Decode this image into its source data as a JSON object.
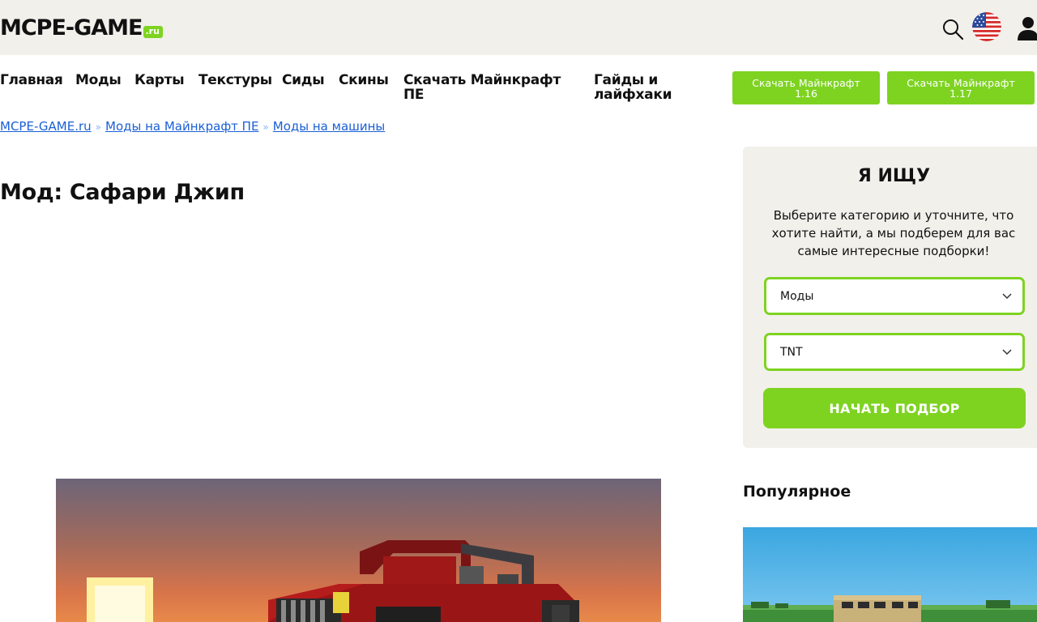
{
  "header": {
    "logo_main": "MCPE-GAME",
    "logo_tld": ".ru"
  },
  "nav": {
    "items": [
      "Главная",
      "Моды",
      "Карты",
      "Текстуры",
      "Сиды",
      "Скины"
    ],
    "download_pe": [
      "Скачать Майнкрафт",
      "ПЕ"
    ],
    "guides": [
      "Гайды и",
      "лайфхаки"
    ],
    "buttons": [
      {
        "line1": "Скачать Майнкрафт",
        "line2": "1.16"
      },
      {
        "line1": "Скачать Майнкрафт",
        "line2": "1.17"
      }
    ]
  },
  "breadcrumb": {
    "items": [
      "MCPE-GAME.ru",
      "Моды на Майнкрафт ПЕ",
      "Моды на машины"
    ],
    "separator": "»"
  },
  "page": {
    "title": "Мод: Сафари Джип"
  },
  "search_box": {
    "title": "Я ИЩУ",
    "text": "Выберите категорию и уточните, что хотите найти, а мы подберем для вас самые интересные подборки!",
    "select1_value": "Моды",
    "select2_value": "TNT",
    "submit_label": "НАЧАТЬ ПОДБОР"
  },
  "popular": {
    "title": "Популярное"
  },
  "colors": {
    "accent": "#7ed321",
    "header_bg": "#f2f0eb",
    "link": "#1a5fd6"
  }
}
